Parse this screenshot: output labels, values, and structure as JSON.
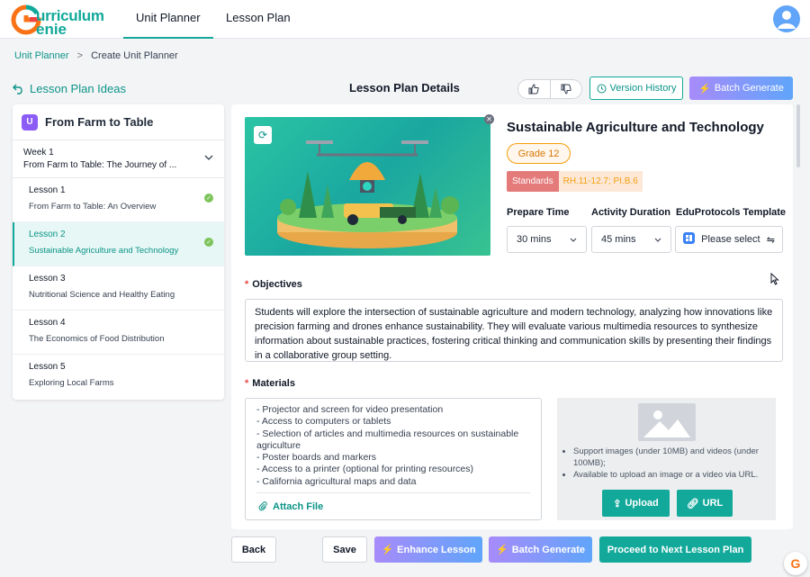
{
  "app": {
    "logo_line1": "urriculum",
    "logo_line2": "enie"
  },
  "nav": {
    "tabs": [
      {
        "label": "Unit Planner",
        "active": true
      },
      {
        "label": "Lesson Plan",
        "active": false
      }
    ]
  },
  "breadcrumb": {
    "link": "Unit Planner",
    "separator": ">",
    "current": "Create Unit Planner"
  },
  "header": {
    "ideas_label": "Lesson Plan Ideas",
    "title": "Lesson Plan Details",
    "version_history": "Version History",
    "batch_generate": "Batch Generate"
  },
  "sidebar": {
    "unit_title": "From Farm to Table",
    "unit_icon_letter": "U",
    "week": {
      "label": "Week 1",
      "subtitle": "From Farm to Table: The Journey of ..."
    },
    "lessons": [
      {
        "label": "Lesson 1",
        "title": "From Farm to Table: An Overview",
        "done": true,
        "active": false
      },
      {
        "label": "Lesson 2",
        "title": "Sustainable Agriculture and Technology",
        "done": true,
        "active": true
      },
      {
        "label": "Lesson 3",
        "title": "Nutritional Science and Healthy Eating",
        "done": false,
        "active": false
      },
      {
        "label": "Lesson 4",
        "title": "The Economics of Food Distribution",
        "done": false,
        "active": false
      },
      {
        "label": "Lesson 5",
        "title": "Exploring Local Farms",
        "done": false,
        "active": false
      }
    ]
  },
  "lesson": {
    "title": "Sustainable Agriculture and Technology",
    "grade": "Grade 12",
    "standards_label": "Standards",
    "standards_value": "RH.11-12.7; PI.B.6",
    "prepare_time": {
      "label": "Prepare Time",
      "value": "30 mins"
    },
    "activity_duration": {
      "label": "Activity Duration",
      "value": "45 mins"
    },
    "template": {
      "label": "EduProtocols Template",
      "value": "Please select"
    },
    "objectives_label": "Objectives",
    "objectives_text": "Students will explore the intersection of sustainable agriculture and modern technology, analyzing how innovations like precision farming and drones enhance sustainability. They will evaluate various multimedia resources to synthesize information about sustainable practices, fostering critical thinking and communication skills by presenting their findings in a collaborative group setting.",
    "materials_label": "Materials",
    "materials": [
      "- Projector and screen for video presentation",
      "- Access to computers or tablets",
      "- Selection of articles and multimedia resources on sustainable agriculture",
      "- Poster boards and markers",
      "- Access to a printer (optional for printing resources)",
      "- California agricultural maps and data"
    ],
    "attach_file": "Attach File"
  },
  "upload": {
    "notes": [
      "Support images (under 10MB) and videos (under 100MB);",
      "Available to upload an image or a video via URL."
    ],
    "upload_label": "Upload",
    "url_label": "URL"
  },
  "footer": {
    "back": "Back",
    "save": "Save",
    "enhance": "Enhance Lesson",
    "batch_generate": "Batch Generate",
    "proceed": "Proceed to Next Lesson Plan"
  },
  "colors": {
    "brand": "#12a99a",
    "accent_gradient_start": "#a78bfa",
    "accent_gradient_end": "#60a5fa",
    "check": "#7cc35a"
  }
}
